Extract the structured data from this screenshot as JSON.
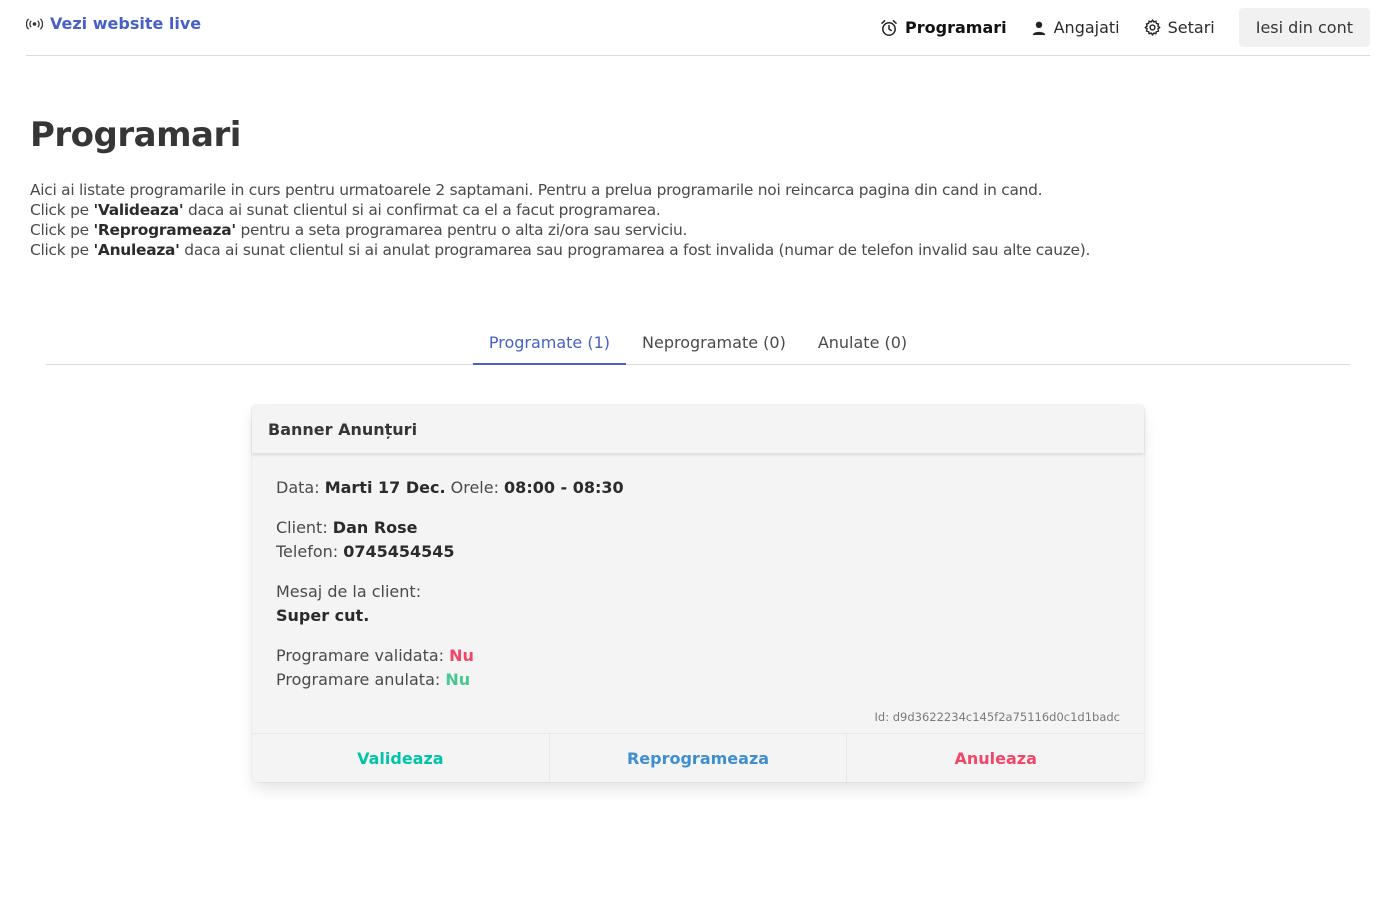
{
  "nav": {
    "live_link": "Vezi website live",
    "items": [
      {
        "label": "Programari",
        "icon": "alarm-clock-icon",
        "active": true
      },
      {
        "label": "Angajati",
        "icon": "user-icon",
        "active": false
      },
      {
        "label": "Setari",
        "icon": "gear-icon",
        "active": false
      }
    ],
    "logout": "Iesi din cont"
  },
  "page": {
    "title": "Programari",
    "intro_line1": "Aici ai listate programarile in curs pentru urmatoarele 2 saptamani. Pentru a prelua programarile noi reincarca pagina din cand in cand.",
    "click_prefix": "Click pe ",
    "validate_term": "'Valideaza'",
    "validate_desc": " daca ai sunat clientul si ai confirmat ca el a facut programarea.",
    "reschedule_term": "'Reprogrameaza'",
    "reschedule_desc": " pentru a seta programarea pentru o alta zi/ora sau serviciu.",
    "cancel_term": "'Anuleaza'",
    "cancel_desc": " daca ai sunat clientul si ai anulat programarea sau programarea a fost invalida (numar de telefon invalid sau alte cauze)."
  },
  "tabs": [
    {
      "label": "Programate (1)",
      "active": true
    },
    {
      "label": "Neprogramate (0)",
      "active": false
    },
    {
      "label": "Anulate (0)",
      "active": false
    }
  ],
  "appointment": {
    "title": "Banner Anunțuri",
    "date_label": "Data: ",
    "date_value": "Marti 17 Dec.",
    "hours_label": " Orele: ",
    "hours_value": "08:00 - 08:30",
    "client_label": "Client: ",
    "client_value": "Dan Rose",
    "phone_label": "Telefon: ",
    "phone_value": "0745454545",
    "message_label": "Mesaj de la client:",
    "message_value": "Super cut.",
    "validated_label": "Programare validata: ",
    "validated_value": "Nu",
    "cancelled_label": "Programare anulata: ",
    "cancelled_value": "Nu",
    "id_text": "Id: d9d3622234c145f2a75116d0c1d1badc",
    "actions": {
      "validate": "Valideaza",
      "reschedule": "Reprogrameaza",
      "cancel": "Anuleaza"
    }
  },
  "colors": {
    "link": "#485fc7",
    "success": "#00c4a7",
    "info": "#3e8ed0",
    "danger": "#f14668",
    "green": "#48c78e"
  }
}
